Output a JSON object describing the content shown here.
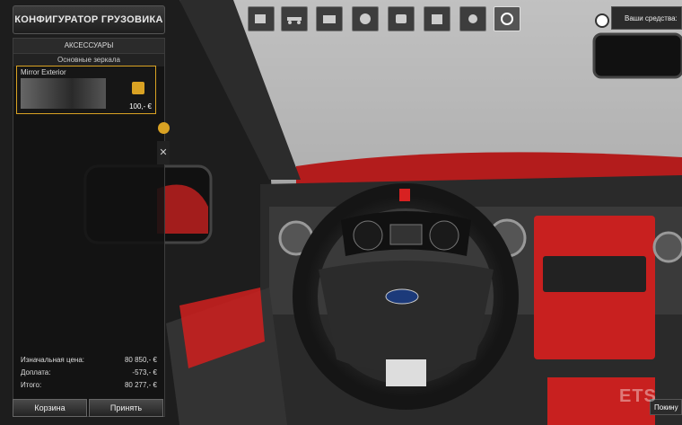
{
  "title": "КОНФИГУРАТОР ГРУЗОВИКА",
  "sidebar": {
    "heading": "АКСЕССУАРЫ",
    "subheading": "Основные зеркала",
    "item": {
      "title": "Mirror Exterior",
      "price": "100,- €"
    }
  },
  "totals": [
    {
      "label": "Изначальная цена:",
      "value": "80 850,- €"
    },
    {
      "label": "Доплата:",
      "value": "-573,- €"
    },
    {
      "label": "Итого:",
      "value": "80 277,- €"
    }
  ],
  "buttons": {
    "cart": "Корзина",
    "accept": "Принять"
  },
  "money": {
    "label": "Ваши средства:"
  },
  "bottom_right": "Покину",
  "watermark": "ETS",
  "categories": [
    "cabin-icon",
    "chassis-icon",
    "engine-icon",
    "transmission-icon",
    "paint-icon",
    "interior-icon",
    "lights-icon",
    "accessories-icon"
  ],
  "colors": {
    "accent": "#d9a223",
    "dash_red": "#c8201f"
  }
}
